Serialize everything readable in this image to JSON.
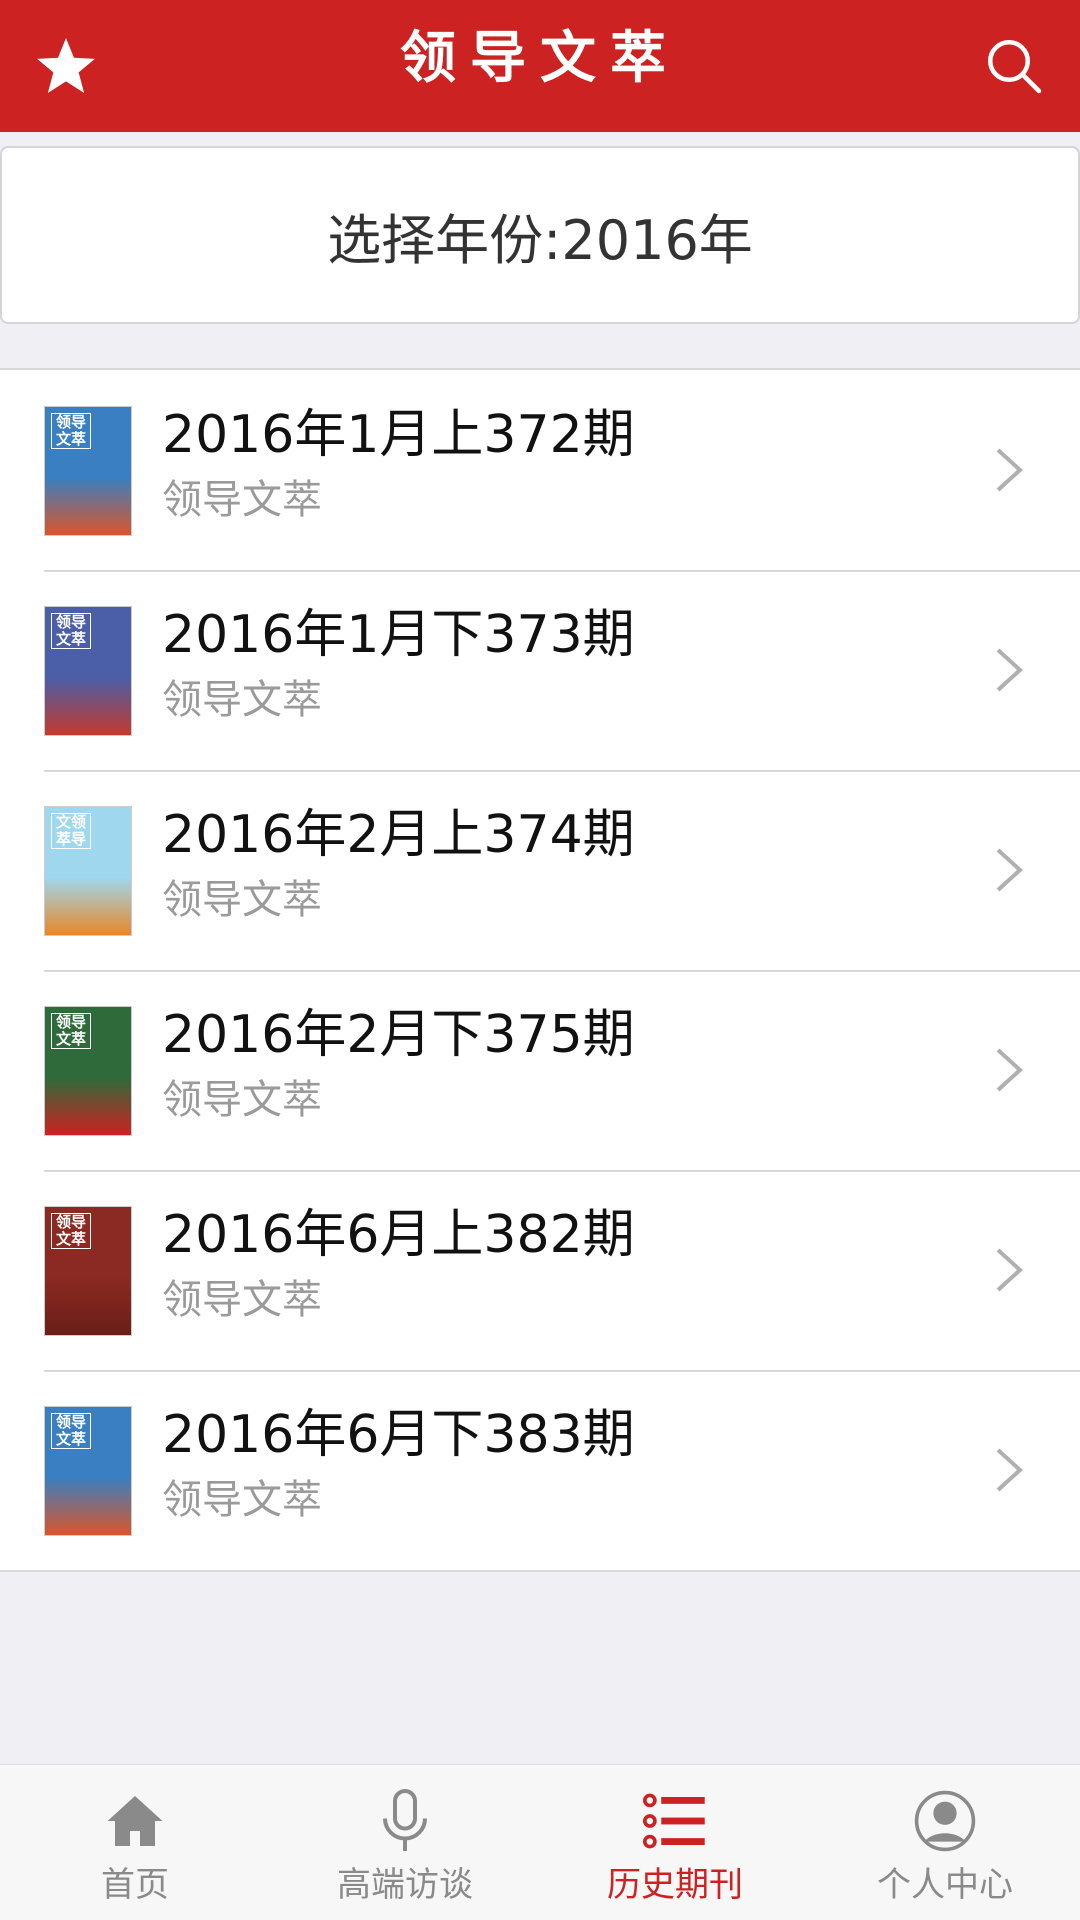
{
  "header": {
    "title": "领导文萃",
    "left_icon": "star-icon",
    "right_icon": "search-icon",
    "bg_color": "#cc2222"
  },
  "year_selector": {
    "label": "选择年份:2016年"
  },
  "issues": [
    {
      "title": "2016年1月上372期",
      "subtitle": "领导文萃",
      "cover_text": "领导\n文萃",
      "cover_colors": [
        "#3a7fc1",
        "#d9562b"
      ]
    },
    {
      "title": "2016年1月下373期",
      "subtitle": "领导文萃",
      "cover_text": "领导\n文萃",
      "cover_colors": [
        "#4a5fa8",
        "#c33a2e"
      ]
    },
    {
      "title": "2016年2月上374期",
      "subtitle": "领导文萃",
      "cover_text": "文领\n萃导",
      "cover_colors": [
        "#9fd7ef",
        "#e8872a"
      ]
    },
    {
      "title": "2016年2月下375期",
      "subtitle": "领导文萃",
      "cover_text": "领导\n文萃",
      "cover_colors": [
        "#2f6b3a",
        "#cc2222"
      ]
    },
    {
      "title": "2016年6月上382期",
      "subtitle": "领导文萃",
      "cover_text": "领导\n文萃",
      "cover_colors": [
        "#8a2a22",
        "#6b1e18"
      ]
    },
    {
      "title": "2016年6月下383期",
      "subtitle": "领导文萃",
      "cover_text": "领导\n文萃",
      "cover_colors": [
        "#3a7fc1",
        "#d9562b"
      ]
    }
  ],
  "tabs": [
    {
      "label": "首页",
      "icon": "home-icon",
      "active": false
    },
    {
      "label": "高端访谈",
      "icon": "microphone-icon",
      "active": false
    },
    {
      "label": "历史期刊",
      "icon": "list-icon",
      "active": true
    },
    {
      "label": "个人中心",
      "icon": "user-icon",
      "active": false
    }
  ],
  "colors": {
    "accent": "#cc2222",
    "inactive": "#8a8a8a",
    "background": "#efeff4"
  }
}
